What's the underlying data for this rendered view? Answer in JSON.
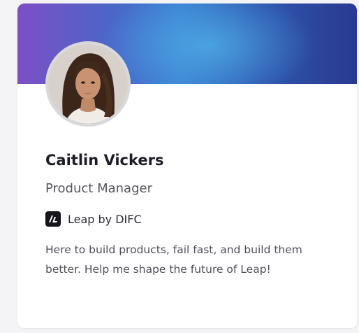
{
  "profile": {
    "name": "Caitlin Vickers",
    "role": "Product Manager",
    "organization": "Leap by DIFC",
    "organization_logo_icon": "leap-logo-icon",
    "bio": "Here to build products, fail fast, and build them better. Help me shape the future of Leap!"
  },
  "colors": {
    "banner_start": "#7d4fc5",
    "banner_mid": "#3a7fd0",
    "banner_end": "#2a3990",
    "card_background": "#ffffff",
    "page_background": "#f4f4f6"
  }
}
